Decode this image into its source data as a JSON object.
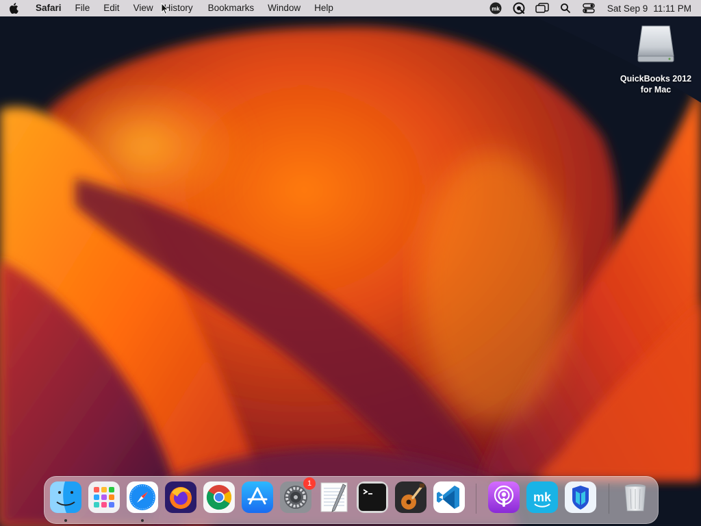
{
  "menubar": {
    "app_name": "Safari",
    "menus": [
      "File",
      "Edit",
      "View",
      "History",
      "Bookmarks",
      "Window",
      "Help"
    ],
    "status_icons": [
      "mk-icon",
      "app-status-icon",
      "screen-mirroring-icon",
      "spotlight-search-icon",
      "control-center-icon"
    ],
    "clock": {
      "date": "Sat Sep 9",
      "time": "11:11 PM"
    }
  },
  "desktop": {
    "icons": [
      {
        "label": "QuickBooks 2012 for Mac",
        "icon": "disk-drive-icon"
      }
    ]
  },
  "dock": {
    "apps": [
      {
        "name": "Finder",
        "icon": "finder-icon",
        "running": true
      },
      {
        "name": "Launchpad",
        "icon": "launchpad-icon",
        "running": false
      },
      {
        "name": "Safari",
        "icon": "safari-icon",
        "running": true
      },
      {
        "name": "Firefox",
        "icon": "firefox-icon",
        "running": false
      },
      {
        "name": "Google Chrome",
        "icon": "chrome-icon",
        "running": false
      },
      {
        "name": "App Store",
        "icon": "app-store-icon",
        "running": false
      },
      {
        "name": "System Settings",
        "icon": "settings-icon",
        "running": false,
        "badge": "1"
      },
      {
        "name": "TextEdit",
        "icon": "textedit-icon",
        "running": false
      },
      {
        "name": "Terminal",
        "icon": "terminal-icon",
        "running": false
      },
      {
        "name": "GarageBand",
        "icon": "garageband-icon",
        "running": false
      },
      {
        "name": "Visual Studio Code",
        "icon": "vscode-icon",
        "running": false
      },
      {
        "name": "Podcasts",
        "icon": "podcasts-icon",
        "running": false
      },
      {
        "name": "mk",
        "icon": "mk-app-icon",
        "running": false
      },
      {
        "name": "Malwarebytes",
        "icon": "malwarebytes-icon",
        "running": false
      },
      {
        "name": "Trash",
        "icon": "trash-icon",
        "running": false
      }
    ]
  },
  "colors": {
    "accent": "#ff6a00",
    "badge": "#ff3b30"
  }
}
